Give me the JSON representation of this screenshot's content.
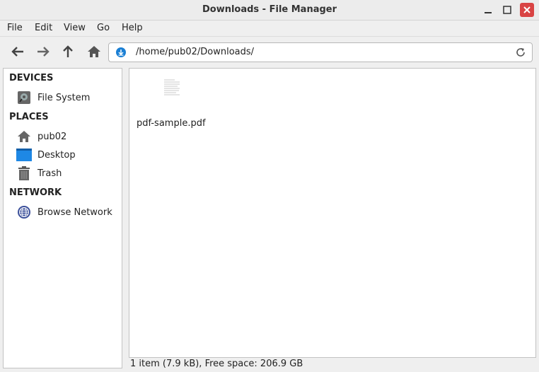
{
  "window": {
    "title": "Downloads - File Manager"
  },
  "menu": {
    "items": [
      "File",
      "Edit",
      "View",
      "Go",
      "Help"
    ]
  },
  "location": {
    "path": "/home/pub02/Downloads/"
  },
  "sidebar": {
    "devices_heading": "DEVICES",
    "places_heading": "PLACES",
    "network_heading": "NETWORK",
    "devices": [
      {
        "label": "File System",
        "icon": "drive-icon"
      }
    ],
    "places": [
      {
        "label": "pub02",
        "icon": "home-icon"
      },
      {
        "label": "Desktop",
        "icon": "desktop-icon"
      },
      {
        "label": "Trash",
        "icon": "trash-icon"
      }
    ],
    "network": [
      {
        "label": "Browse Network",
        "icon": "globe-icon"
      }
    ]
  },
  "files": [
    {
      "name": "pdf-sample.pdf",
      "icon": "pdf-thumbnail-icon"
    }
  ],
  "status": {
    "text": "1 item (7.9 kB), Free space: 206.9 GB"
  },
  "colors": {
    "accent": "#1a7fd4",
    "close_button": "#d94444",
    "desktop_blue": "#1e88e5"
  }
}
